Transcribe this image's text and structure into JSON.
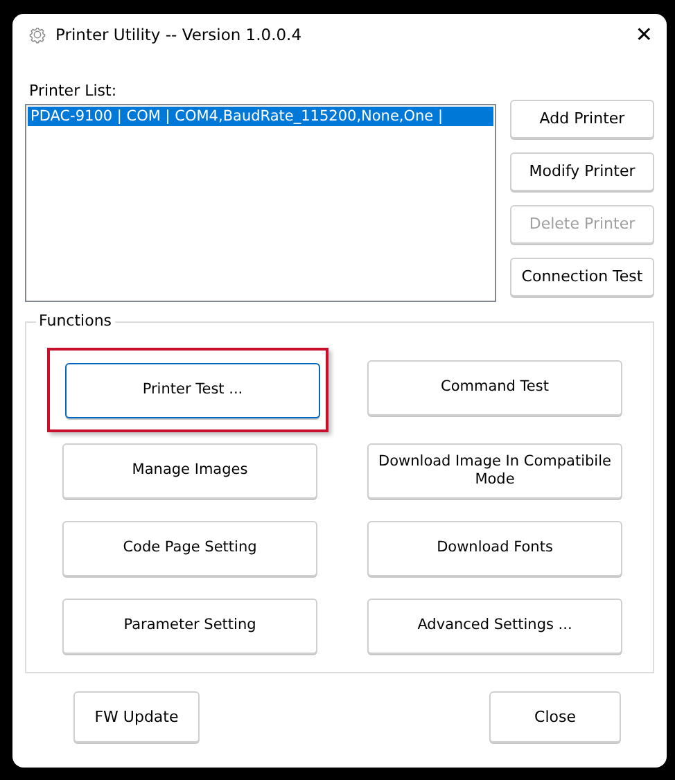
{
  "window": {
    "title": "Printer Utility -- Version 1.0.0.4",
    "close_glyph": "✕"
  },
  "printer_list": {
    "label": "Printer List:",
    "items": [
      {
        "text": "PDAC-9100 | COM | COM4,BaudRate_115200,None,One |",
        "selected": true
      }
    ]
  },
  "printer_buttons": [
    {
      "label": "Add Printer",
      "disabled": false
    },
    {
      "label": "Modify Printer",
      "disabled": false
    },
    {
      "label": "Delete Printer",
      "disabled": true
    },
    {
      "label": "Connection Test",
      "disabled": false
    }
  ],
  "functions": {
    "title": "Functions",
    "buttons": [
      {
        "label": "Printer Test ...",
        "focused": true,
        "highlighted": true
      },
      {
        "label": "Command Test",
        "focused": false,
        "highlighted": false
      },
      {
        "label": "Manage Images",
        "focused": false,
        "highlighted": false
      },
      {
        "label": "Download Image In Compatibile Mode",
        "focused": false,
        "highlighted": false
      },
      {
        "label": "Code Page Setting",
        "focused": false,
        "highlighted": false
      },
      {
        "label": "Download Fonts",
        "focused": false,
        "highlighted": false
      },
      {
        "label": "Parameter Setting",
        "focused": false,
        "highlighted": false
      },
      {
        "label": "Advanced Settings ...",
        "focused": false,
        "highlighted": false
      }
    ]
  },
  "footer_buttons": [
    "FW Update",
    "Close"
  ]
}
